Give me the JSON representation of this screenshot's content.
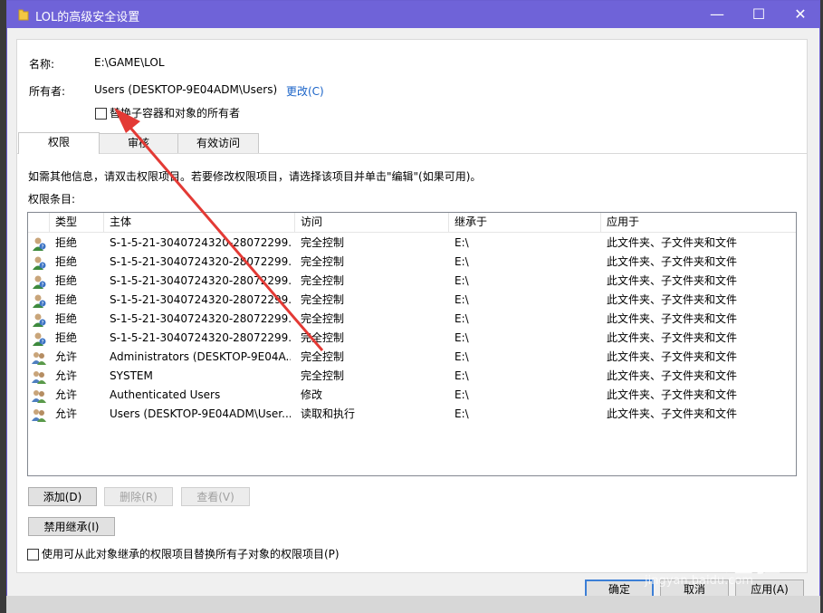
{
  "window": {
    "title": "LOL的高级安全设置",
    "minimize": "—",
    "maximize": "☐",
    "close": "✕"
  },
  "info": {
    "name_label": "名称:",
    "name_value": "E:\\GAME\\LOL",
    "owner_label": "所有者:",
    "owner_value": "Users (DESKTOP-9E04ADM\\Users)",
    "change_link": "更改(C)",
    "replace_owner_checkbox": "替换子容器和对象的所有者"
  },
  "tabs": [
    {
      "label": "权限"
    },
    {
      "label": "审核"
    },
    {
      "label": "有效访问"
    }
  ],
  "hint": "如需其他信息，请双击权限项目。若要修改权限项目，请选择该项目并单击\"编辑\"(如果可用)。",
  "entries_label": "权限条目:",
  "table": {
    "columns": [
      "类型",
      "主体",
      "访问",
      "继承于",
      "应用于"
    ],
    "rows": [
      {
        "type": "拒绝",
        "principal": "S-1-5-21-3040724320-28072299...",
        "access": "完全控制",
        "inherited": "E:\\",
        "applies": "此文件夹、子文件夹和文件",
        "icon": "unknown-user-icon"
      },
      {
        "type": "拒绝",
        "principal": "S-1-5-21-3040724320-28072299...",
        "access": "完全控制",
        "inherited": "E:\\",
        "applies": "此文件夹、子文件夹和文件",
        "icon": "unknown-user-icon"
      },
      {
        "type": "拒绝",
        "principal": "S-1-5-21-3040724320-28072299...",
        "access": "完全控制",
        "inherited": "E:\\",
        "applies": "此文件夹、子文件夹和文件",
        "icon": "unknown-user-icon"
      },
      {
        "type": "拒绝",
        "principal": "S-1-5-21-3040724320-28072299...",
        "access": "完全控制",
        "inherited": "E:\\",
        "applies": "此文件夹、子文件夹和文件",
        "icon": "unknown-user-icon"
      },
      {
        "type": "拒绝",
        "principal": "S-1-5-21-3040724320-28072299...",
        "access": "完全控制",
        "inherited": "E:\\",
        "applies": "此文件夹、子文件夹和文件",
        "icon": "unknown-user-icon"
      },
      {
        "type": "拒绝",
        "principal": "S-1-5-21-3040724320-28072299...",
        "access": "完全控制",
        "inherited": "E:\\",
        "applies": "此文件夹、子文件夹和文件",
        "icon": "unknown-user-icon"
      },
      {
        "type": "允许",
        "principal": "Administrators (DESKTOP-9E04A...",
        "access": "完全控制",
        "inherited": "E:\\",
        "applies": "此文件夹、子文件夹和文件",
        "icon": "group-icon"
      },
      {
        "type": "允许",
        "principal": "SYSTEM",
        "access": "完全控制",
        "inherited": "E:\\",
        "applies": "此文件夹、子文件夹和文件",
        "icon": "group-icon"
      },
      {
        "type": "允许",
        "principal": "Authenticated Users",
        "access": "修改",
        "inherited": "E:\\",
        "applies": "此文件夹、子文件夹和文件",
        "icon": "group-icon"
      },
      {
        "type": "允许",
        "principal": "Users (DESKTOP-9E04ADM\\User...",
        "access": "读取和执行",
        "inherited": "E:\\",
        "applies": "此文件夹、子文件夹和文件",
        "icon": "group-icon"
      }
    ]
  },
  "buttons": {
    "add": "添加(D)",
    "remove": "删除(R)",
    "view": "查看(V)",
    "disable_inheritance": "禁用继承(I)",
    "ok": "确定",
    "cancel": "取消",
    "apply": "应用(A)"
  },
  "replace_child_checkbox": "使用可从此对象继承的权限项目替换所有子对象的权限项目(P)",
  "watermark": {
    "brand": "Baidu经验",
    "url": "jingyan.baidu.com"
  },
  "colors": {
    "titlebar": "#6f63d8",
    "link": "#1a63c8",
    "arrow": "#e33a35"
  }
}
